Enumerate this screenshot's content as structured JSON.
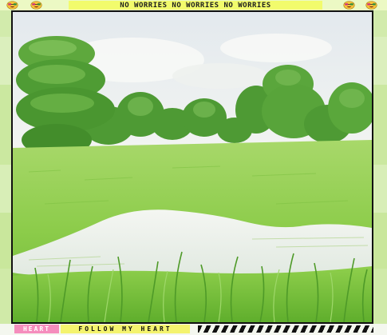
{
  "top_banner": {
    "text": "NO WORRIES NO WORRIES NO WORRIES",
    "emoji_icon": "grinning-face-with-glasses-icon"
  },
  "bottom_banner": {
    "heart_label": "HEART",
    "follow_label": "FOLLOW MY HEART"
  },
  "colors": {
    "background": "#c7e79b",
    "banner_yellow": "#f2fb6c",
    "heart_pink": "#f58dbd",
    "frame_border": "#111111"
  }
}
